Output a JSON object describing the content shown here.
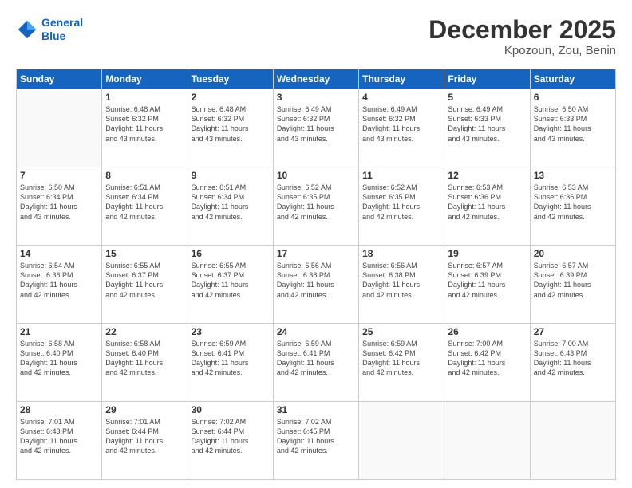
{
  "header": {
    "logo_line1": "General",
    "logo_line2": "Blue",
    "month": "December 2025",
    "location": "Kpozoun, Zou, Benin"
  },
  "weekdays": [
    "Sunday",
    "Monday",
    "Tuesday",
    "Wednesday",
    "Thursday",
    "Friday",
    "Saturday"
  ],
  "weeks": [
    [
      {
        "day": "",
        "info": ""
      },
      {
        "day": "1",
        "info": "Sunrise: 6:48 AM\nSunset: 6:32 PM\nDaylight: 11 hours\nand 43 minutes."
      },
      {
        "day": "2",
        "info": "Sunrise: 6:48 AM\nSunset: 6:32 PM\nDaylight: 11 hours\nand 43 minutes."
      },
      {
        "day": "3",
        "info": "Sunrise: 6:49 AM\nSunset: 6:32 PM\nDaylight: 11 hours\nand 43 minutes."
      },
      {
        "day": "4",
        "info": "Sunrise: 6:49 AM\nSunset: 6:32 PM\nDaylight: 11 hours\nand 43 minutes."
      },
      {
        "day": "5",
        "info": "Sunrise: 6:49 AM\nSunset: 6:33 PM\nDaylight: 11 hours\nand 43 minutes."
      },
      {
        "day": "6",
        "info": "Sunrise: 6:50 AM\nSunset: 6:33 PM\nDaylight: 11 hours\nand 43 minutes."
      }
    ],
    [
      {
        "day": "7",
        "info": "Sunrise: 6:50 AM\nSunset: 6:34 PM\nDaylight: 11 hours\nand 43 minutes."
      },
      {
        "day": "8",
        "info": "Sunrise: 6:51 AM\nSunset: 6:34 PM\nDaylight: 11 hours\nand 42 minutes."
      },
      {
        "day": "9",
        "info": "Sunrise: 6:51 AM\nSunset: 6:34 PM\nDaylight: 11 hours\nand 42 minutes."
      },
      {
        "day": "10",
        "info": "Sunrise: 6:52 AM\nSunset: 6:35 PM\nDaylight: 11 hours\nand 42 minutes."
      },
      {
        "day": "11",
        "info": "Sunrise: 6:52 AM\nSunset: 6:35 PM\nDaylight: 11 hours\nand 42 minutes."
      },
      {
        "day": "12",
        "info": "Sunrise: 6:53 AM\nSunset: 6:36 PM\nDaylight: 11 hours\nand 42 minutes."
      },
      {
        "day": "13",
        "info": "Sunrise: 6:53 AM\nSunset: 6:36 PM\nDaylight: 11 hours\nand 42 minutes."
      }
    ],
    [
      {
        "day": "14",
        "info": "Sunrise: 6:54 AM\nSunset: 6:36 PM\nDaylight: 11 hours\nand 42 minutes."
      },
      {
        "day": "15",
        "info": "Sunrise: 6:55 AM\nSunset: 6:37 PM\nDaylight: 11 hours\nand 42 minutes."
      },
      {
        "day": "16",
        "info": "Sunrise: 6:55 AM\nSunset: 6:37 PM\nDaylight: 11 hours\nand 42 minutes."
      },
      {
        "day": "17",
        "info": "Sunrise: 6:56 AM\nSunset: 6:38 PM\nDaylight: 11 hours\nand 42 minutes."
      },
      {
        "day": "18",
        "info": "Sunrise: 6:56 AM\nSunset: 6:38 PM\nDaylight: 11 hours\nand 42 minutes."
      },
      {
        "day": "19",
        "info": "Sunrise: 6:57 AM\nSunset: 6:39 PM\nDaylight: 11 hours\nand 42 minutes."
      },
      {
        "day": "20",
        "info": "Sunrise: 6:57 AM\nSunset: 6:39 PM\nDaylight: 11 hours\nand 42 minutes."
      }
    ],
    [
      {
        "day": "21",
        "info": "Sunrise: 6:58 AM\nSunset: 6:40 PM\nDaylight: 11 hours\nand 42 minutes."
      },
      {
        "day": "22",
        "info": "Sunrise: 6:58 AM\nSunset: 6:40 PM\nDaylight: 11 hours\nand 42 minutes."
      },
      {
        "day": "23",
        "info": "Sunrise: 6:59 AM\nSunset: 6:41 PM\nDaylight: 11 hours\nand 42 minutes."
      },
      {
        "day": "24",
        "info": "Sunrise: 6:59 AM\nSunset: 6:41 PM\nDaylight: 11 hours\nand 42 minutes."
      },
      {
        "day": "25",
        "info": "Sunrise: 6:59 AM\nSunset: 6:42 PM\nDaylight: 11 hours\nand 42 minutes."
      },
      {
        "day": "26",
        "info": "Sunrise: 7:00 AM\nSunset: 6:42 PM\nDaylight: 11 hours\nand 42 minutes."
      },
      {
        "day": "27",
        "info": "Sunrise: 7:00 AM\nSunset: 6:43 PM\nDaylight: 11 hours\nand 42 minutes."
      }
    ],
    [
      {
        "day": "28",
        "info": "Sunrise: 7:01 AM\nSunset: 6:43 PM\nDaylight: 11 hours\nand 42 minutes."
      },
      {
        "day": "29",
        "info": "Sunrise: 7:01 AM\nSunset: 6:44 PM\nDaylight: 11 hours\nand 42 minutes."
      },
      {
        "day": "30",
        "info": "Sunrise: 7:02 AM\nSunset: 6:44 PM\nDaylight: 11 hours\nand 42 minutes."
      },
      {
        "day": "31",
        "info": "Sunrise: 7:02 AM\nSunset: 6:45 PM\nDaylight: 11 hours\nand 42 minutes."
      },
      {
        "day": "",
        "info": ""
      },
      {
        "day": "",
        "info": ""
      },
      {
        "day": "",
        "info": ""
      }
    ]
  ]
}
